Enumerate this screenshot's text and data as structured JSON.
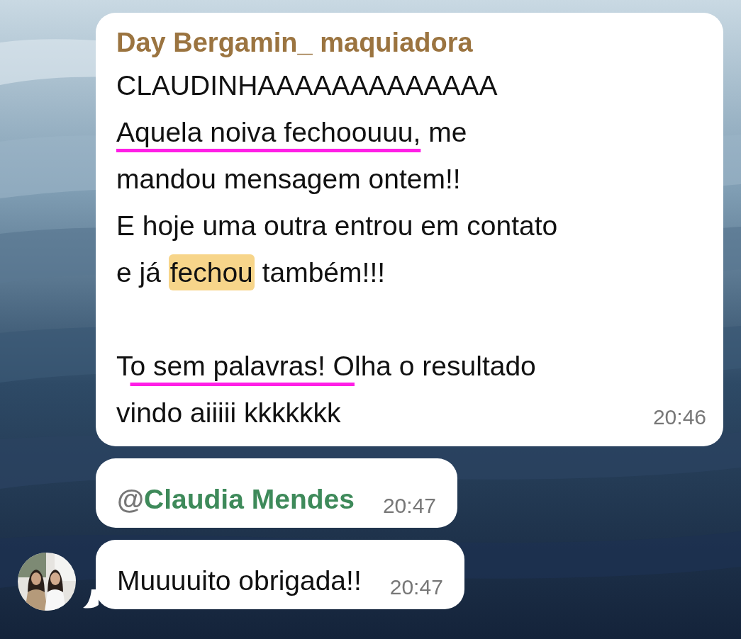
{
  "messages": [
    {
      "kind": "text",
      "sender": "Day Bergamin_ maquiadora",
      "paragraphs": [
        [
          [
            {
              "kind": "plain",
              "text": "CLAUDINHAAAAAAAAAAAAA"
            }
          ],
          [
            {
              "kind": "underline",
              "text": "Aquela noiva fechoouuu,"
            },
            {
              "kind": "plain",
              "text": " me"
            }
          ],
          [
            {
              "kind": "plain",
              "text": "mandou mensagem ontem!!"
            }
          ],
          [
            {
              "kind": "plain",
              "text": "E hoje uma outra entrou em contato"
            }
          ],
          [
            {
              "kind": "plain",
              "text": "e já "
            },
            {
              "kind": "highlight",
              "text": "fechou"
            },
            {
              "kind": "plain",
              "text": " também!!!"
            }
          ]
        ],
        [
          [
            {
              "kind": "plain",
              "text": "T"
            },
            {
              "kind": "underline",
              "text": "o sem palavras! O"
            },
            {
              "kind": "plain",
              "text": "lha o resultado"
            }
          ],
          [
            {
              "kind": "plain",
              "text": "vindo aiiiii kkkkkkk"
            }
          ]
        ]
      ],
      "time": "20:46"
    },
    {
      "kind": "mention",
      "prefix": "@",
      "name": "Claudia Mendes",
      "time": "20:47"
    },
    {
      "kind": "plain",
      "text": "Muuuuito obrigada!!",
      "time": "20:47",
      "tail": true
    }
  ]
}
